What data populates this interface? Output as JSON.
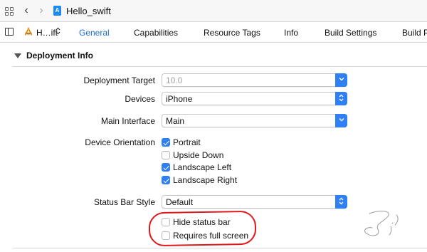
{
  "nav": {
    "title": "Hello_swift",
    "back_glyph": "‹",
    "forward_glyph": "›",
    "icons": [
      "grid-icon",
      "back-arrow-icon",
      "forward-arrow-icon",
      "swift-file-icon"
    ]
  },
  "tabbar": {
    "target_label": "H…ift",
    "target_chevron": "⌃⌄",
    "tabs": [
      {
        "label": "General",
        "active": true
      },
      {
        "label": "Capabilities",
        "active": false
      },
      {
        "label": "Resource Tags",
        "active": false
      },
      {
        "label": "Info",
        "active": false
      },
      {
        "label": "Build Settings",
        "active": false
      },
      {
        "label": "Build P",
        "active": false
      }
    ]
  },
  "section": {
    "title": "Deployment Info",
    "expanded": true
  },
  "form": {
    "deployment_target": {
      "label": "Deployment Target",
      "value": "10.0",
      "control": "popup-down"
    },
    "devices": {
      "label": "Devices",
      "value": "iPhone",
      "control": "popup-updown"
    },
    "main_interface": {
      "label": "Main Interface",
      "value": "Main",
      "control": "popup-down"
    },
    "device_orientation": {
      "label": "Device Orientation",
      "options": [
        {
          "label": "Portrait",
          "checked": true
        },
        {
          "label": "Upside Down",
          "checked": false
        },
        {
          "label": "Landscape Left",
          "checked": true
        },
        {
          "label": "Landscape Right",
          "checked": true
        }
      ]
    },
    "status_bar_style": {
      "label": "Status Bar Style",
      "value": "Default",
      "control": "popup-updown"
    },
    "hide_status_bar": {
      "label": "Hide status bar",
      "checked": false
    },
    "requires_full_screen": {
      "label": "Requires full screen",
      "checked": false
    }
  },
  "colors": {
    "accent": "#2f7ff5",
    "active_tab": "#1a6fd6",
    "annotation_red": "#e0161b"
  }
}
